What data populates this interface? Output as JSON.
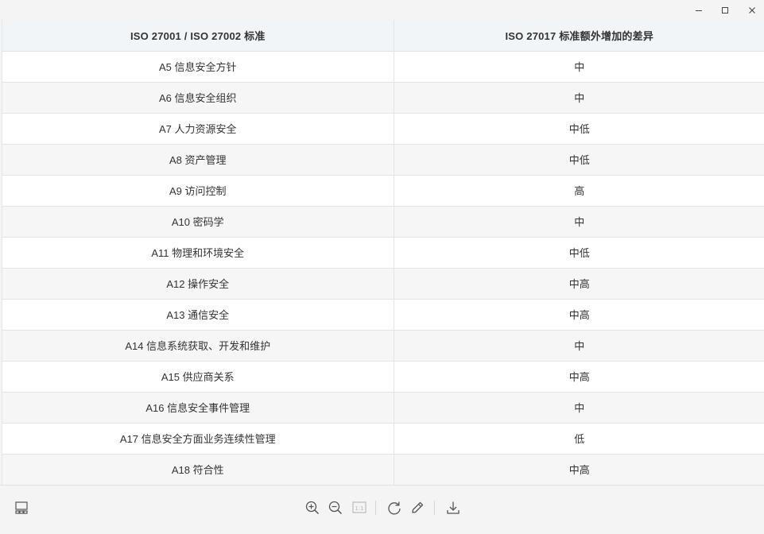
{
  "window": {
    "controls": [
      "minimize-icon",
      "maximize-icon",
      "close-icon"
    ]
  },
  "table": {
    "headers": [
      "ISO 27001 / ISO 27002 标准",
      "ISO 27017 标准额外增加的差异"
    ],
    "rows": [
      [
        "A5 信息安全方针",
        "中"
      ],
      [
        "A6 信息安全组织",
        "中"
      ],
      [
        "A7 人力资源安全",
        "中低"
      ],
      [
        "A8 资产管理",
        "中低"
      ],
      [
        "A9 访问控制",
        "高"
      ],
      [
        "A10 密码学",
        "中"
      ],
      [
        "A11 物理和环境安全",
        "中低"
      ],
      [
        "A12 操作安全",
        "中高"
      ],
      [
        "A13 通信安全",
        "中高"
      ],
      [
        "A14 信息系统获取、开发和维护",
        "中"
      ],
      [
        "A15 供应商关系",
        "中高"
      ],
      [
        "A16 信息安全事件管理",
        "中"
      ],
      [
        "A17 信息安全方面业务连续性管理",
        "低"
      ],
      [
        "A18 符合性",
        "中高"
      ]
    ]
  },
  "toolbar": {
    "layout_icon": "panel-layout-icon",
    "zoom_in_icon": "zoom-in-icon",
    "zoom_out_icon": "zoom-out-icon",
    "ratio_label": "1:1",
    "rotate_icon": "rotate-icon",
    "edit_icon": "pencil-icon",
    "download_icon": "download-icon"
  },
  "colors": {
    "header_bg": "#f2f5f8",
    "row_alt_bg": "#f6f6f6",
    "icon_color": "#555555",
    "disabled_icon_color": "#bbbbbb"
  }
}
